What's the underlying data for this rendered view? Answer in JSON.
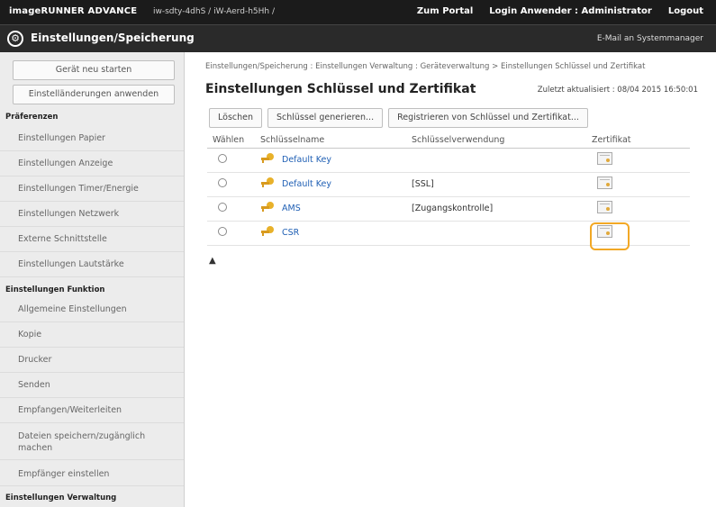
{
  "topbar": {
    "brand": "imageRUNNER ADVANCE",
    "hostname": "iw-sdty-4dhS / iW-Aerd-h5Hh /",
    "portal": "Zum Portal",
    "login_user": "Login Anwender : Administrator",
    "logout": "Logout"
  },
  "titlebar": {
    "title": "Einstellungen/Speicherung",
    "email_link": "E-Mail an Systemmanager"
  },
  "sidebar": {
    "restart_button": "Gerät neu starten",
    "apply_button": "Einstelländerungen anwenden",
    "sections": [
      {
        "heading": "Präferenzen"
      },
      {
        "heading": "Einstellungen Funktion"
      },
      {
        "heading": "Einstellungen Verwaltung"
      }
    ],
    "items": [
      "Einstellungen Papier",
      "Einstellungen Anzeige",
      "Einstellungen Timer/Energie",
      "Einstellungen Netzwerk",
      "Externe Schnittstelle",
      "Einstellungen Lautstärke",
      "Allgemeine Einstellungen",
      "Kopie",
      "Drucker",
      "Senden",
      "Empfangen/Weiterleiten",
      "Dateien speichern/zugänglich machen",
      "Empfänger einstellen"
    ]
  },
  "main": {
    "breadcrumb": "Einstellungen/Speicherung : Einstellungen Verwaltung : Geräteverwaltung > Einstellungen Schlüssel und Zertifikat",
    "title": "Einstellungen Schlüssel und Zertifikat",
    "updated": "Zuletzt aktualisiert : 08/04 2015 16:50:01",
    "toolbar": {
      "delete": "Löschen",
      "generate": "Schlüssel generieren...",
      "register": "Registrieren von Schlüssel und Zertifikat..."
    },
    "table": {
      "headers": [
        "Wählen",
        "Schlüsselname",
        "Schlüsselverwendung",
        "Zertifikat"
      ],
      "rows": [
        {
          "name": "Default Key",
          "usage": ""
        },
        {
          "name": "Default Key",
          "usage": "[SSL]"
        },
        {
          "name": "AMS",
          "usage": "[Zugangskontrolle]"
        },
        {
          "name": "CSR",
          "usage": ""
        }
      ]
    },
    "collapse_label": "▲"
  },
  "colors": {
    "topbar_bg": "#1b1b1b",
    "link": "#1f5fb4",
    "highlight": "#f2a825",
    "key_icon": "#e8b12a"
  }
}
